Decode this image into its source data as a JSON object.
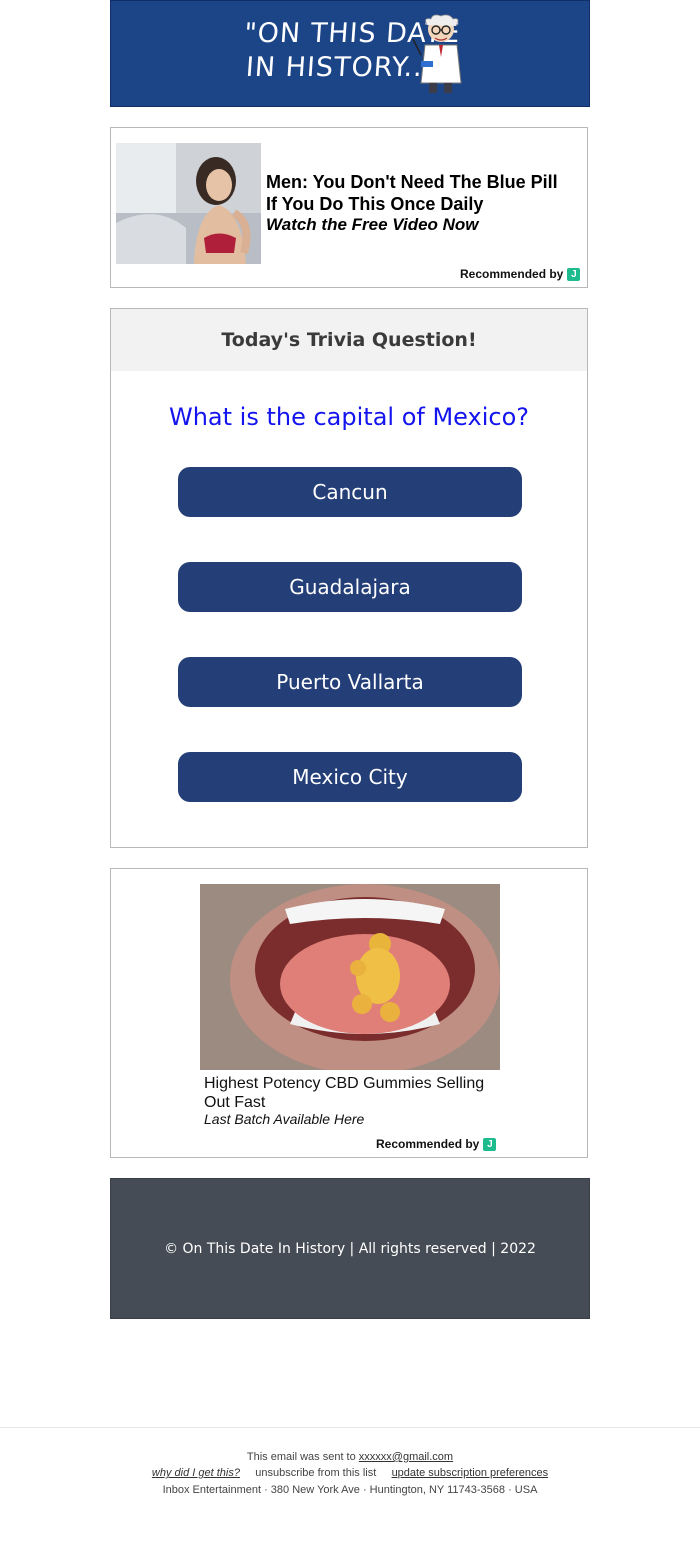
{
  "header": {
    "logo_line1": "\"ON THIS DATE",
    "logo_line2": "IN HISTORY...\""
  },
  "ad_top": {
    "headline": "Men: You Don't Need The Blue Pill If You Do This Once Daily",
    "subline": "Watch the Free Video Now",
    "recommended_label": "Recommended by",
    "badge_letter": "J"
  },
  "trivia": {
    "title": "Today's Trivia Question!",
    "question": "What is the capital of Mexico?",
    "answers": [
      "Cancun",
      "Guadalajara",
      "Puerto Vallarta",
      "Mexico City"
    ]
  },
  "ad_bottom": {
    "headline": "Highest Potency CBD Gummies Selling Out Fast",
    "subline": "Last Batch Available Here",
    "recommended_label": "Recommended by",
    "badge_letter": "J"
  },
  "footer": {
    "copyright": "© On This Date In History | All rights reserved | 2022"
  },
  "email_footer": {
    "sent_prefix": "This email was sent to ",
    "sent_email": "xxxxxx@gmail.com",
    "why_link": "why did I get this?",
    "unsubscribe": "unsubscribe from this list",
    "update_link": "update subscription preferences",
    "address": "Inbox Entertainment · 380 New York Ave · Huntington, NY 11743-3568 · USA"
  },
  "colors": {
    "header_bg": "#1c4588",
    "button_bg": "#243f78",
    "question_text": "#1414ee",
    "footer_bg": "#464c55",
    "badge": "#1dbb8e"
  }
}
